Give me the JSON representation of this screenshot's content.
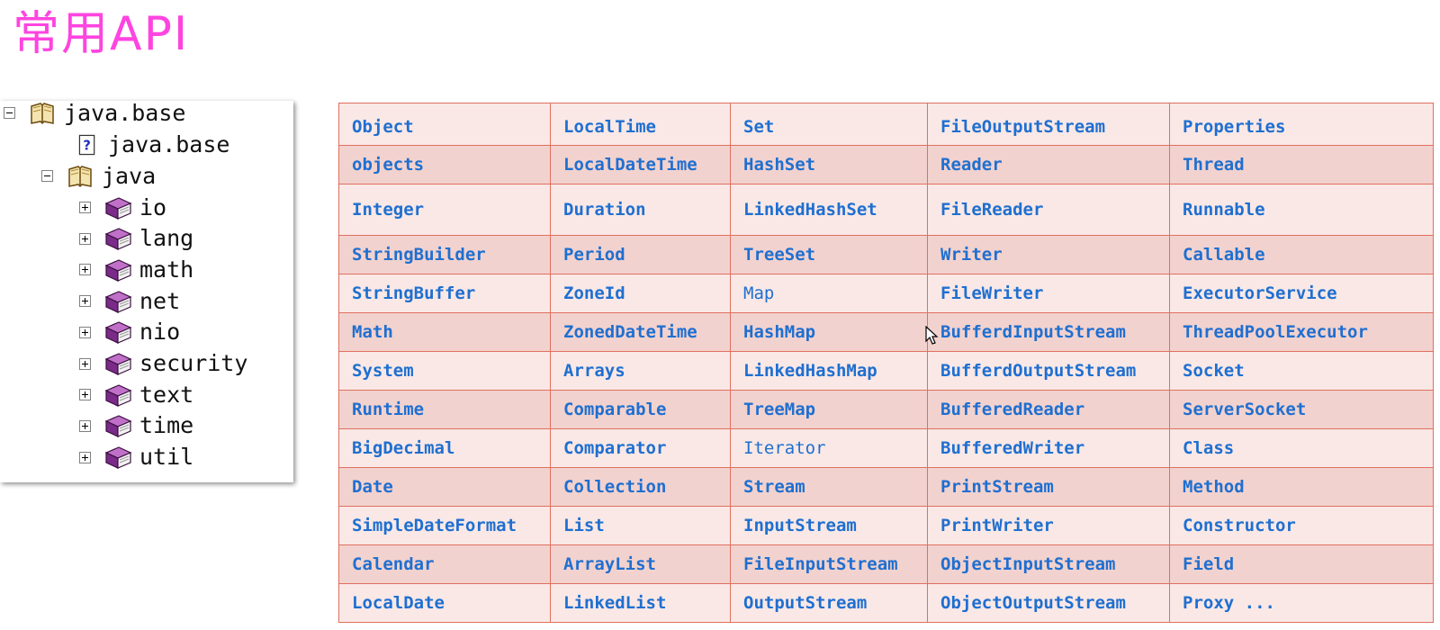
{
  "slide": {
    "title": "常用API"
  },
  "tree": {
    "root_label": "java.base",
    "module_info_label": "java.base",
    "java_label": "java",
    "packages": [
      "io",
      "lang",
      "math",
      "net",
      "nio",
      "security",
      "text",
      "time",
      "util"
    ]
  },
  "colors": {
    "title": "#ff44e0",
    "table_text": "#1f6fd0",
    "table_border": "#e07060",
    "row_light": "#f9e8e6",
    "row_dark": "#f2d2ce"
  },
  "api_table": {
    "rows": [
      [
        "Object",
        "LocalTime",
        "Set",
        "FileOutputStream",
        "Properties"
      ],
      [
        "objects",
        "LocalDateTime",
        "HashSet",
        "Reader",
        "Thread"
      ],
      [
        "Integer",
        "Duration",
        "LinkedHashSet",
        "FileReader",
        "Runnable"
      ],
      [
        "StringBuilder",
        "Period",
        "TreeSet",
        "Writer",
        "Callable"
      ],
      [
        "StringBuffer",
        "ZoneId",
        "Map",
        "FileWriter",
        "ExecutorService"
      ],
      [
        "Math",
        "ZonedDateTime",
        "HashMap",
        "BufferdInputStream",
        "ThreadPoolExecutor"
      ],
      [
        "System",
        "Arrays",
        "LinkedHashMap",
        "BufferdOutputStream",
        "Socket"
      ],
      [
        "Runtime",
        "Comparable",
        "TreeMap",
        "BufferedReader",
        "ServerSocket"
      ],
      [
        "BigDecimal",
        "Comparator",
        "Iterator",
        "BufferedWriter",
        "Class"
      ],
      [
        "Date",
        "Collection",
        "Stream",
        "PrintStream",
        "Method"
      ],
      [
        "SimpleDateFormat",
        "List",
        "InputStream",
        "PrintWriter",
        "Constructor"
      ],
      [
        "Calendar",
        "ArrayList",
        "FileInputStream",
        "ObjectInputStream",
        "Field"
      ],
      [
        "LocalDate",
        "LinkedList",
        "OutputStream",
        "ObjectOutputStream",
        "Proxy ..."
      ]
    ]
  }
}
